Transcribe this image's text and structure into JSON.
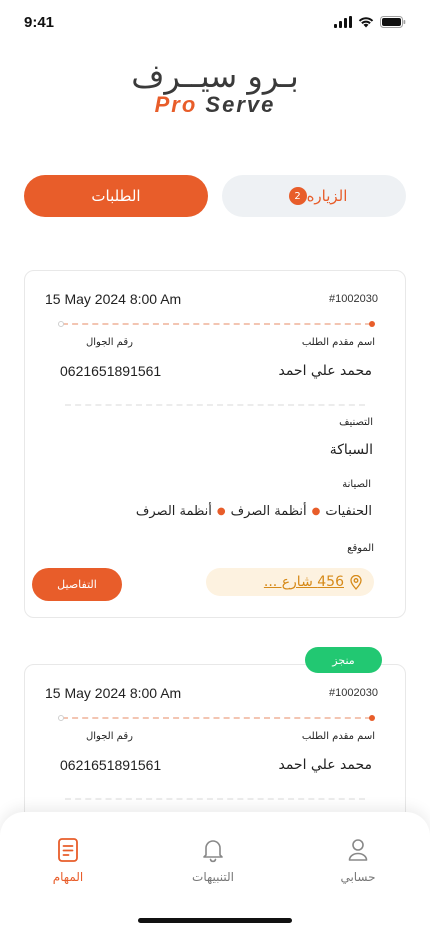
{
  "status_bar": {
    "time": "9:41"
  },
  "logo": {
    "arabic_part1": "بـرو",
    "arabic_part2": "سيــرف",
    "english_pro": "Pro",
    "english_serve": "Serve"
  },
  "tabs": {
    "orders_label": "الطلبات",
    "visit_label": "الزياره",
    "visit_badge": "2"
  },
  "orders": [
    {
      "date": "15 May 2024 8:00 Am",
      "id": "#1002030",
      "applicant_label": "اسم مقدم الطلب",
      "applicant": "محمد علي احمد",
      "phone_label": "رقم الجوال",
      "phone": "0621651891561",
      "category_label": "التصنيف",
      "category": "السباكة",
      "maintenance_label": "الصيانة",
      "maintenance": [
        "الحنفيات",
        "أنظمة الصرف",
        "أنظمة الصرف"
      ],
      "location_label": "الموقع",
      "location": "456 شارع ...",
      "details_button": "التفاصيل"
    },
    {
      "status_badge": "منجز",
      "date": "15 May 2024 8:00 Am",
      "id": "#1002030",
      "applicant_label": "اسم مقدم الطلب",
      "applicant": "محمد علي احمد",
      "phone_label": "رقم الجوال",
      "phone": "0621651891561"
    }
  ],
  "bottom_nav": {
    "tasks": "المهام",
    "notifications": "التنبيهات",
    "account": "حسابي"
  },
  "colors": {
    "accent": "#e85d2a",
    "success": "#22c872",
    "location_bg": "#fdf2e0",
    "location_text": "#d68a19"
  },
  "icons": [
    "signal-icon",
    "wifi-icon",
    "battery-icon",
    "location-pin-icon",
    "tasks-icon",
    "bell-icon",
    "user-icon"
  ]
}
